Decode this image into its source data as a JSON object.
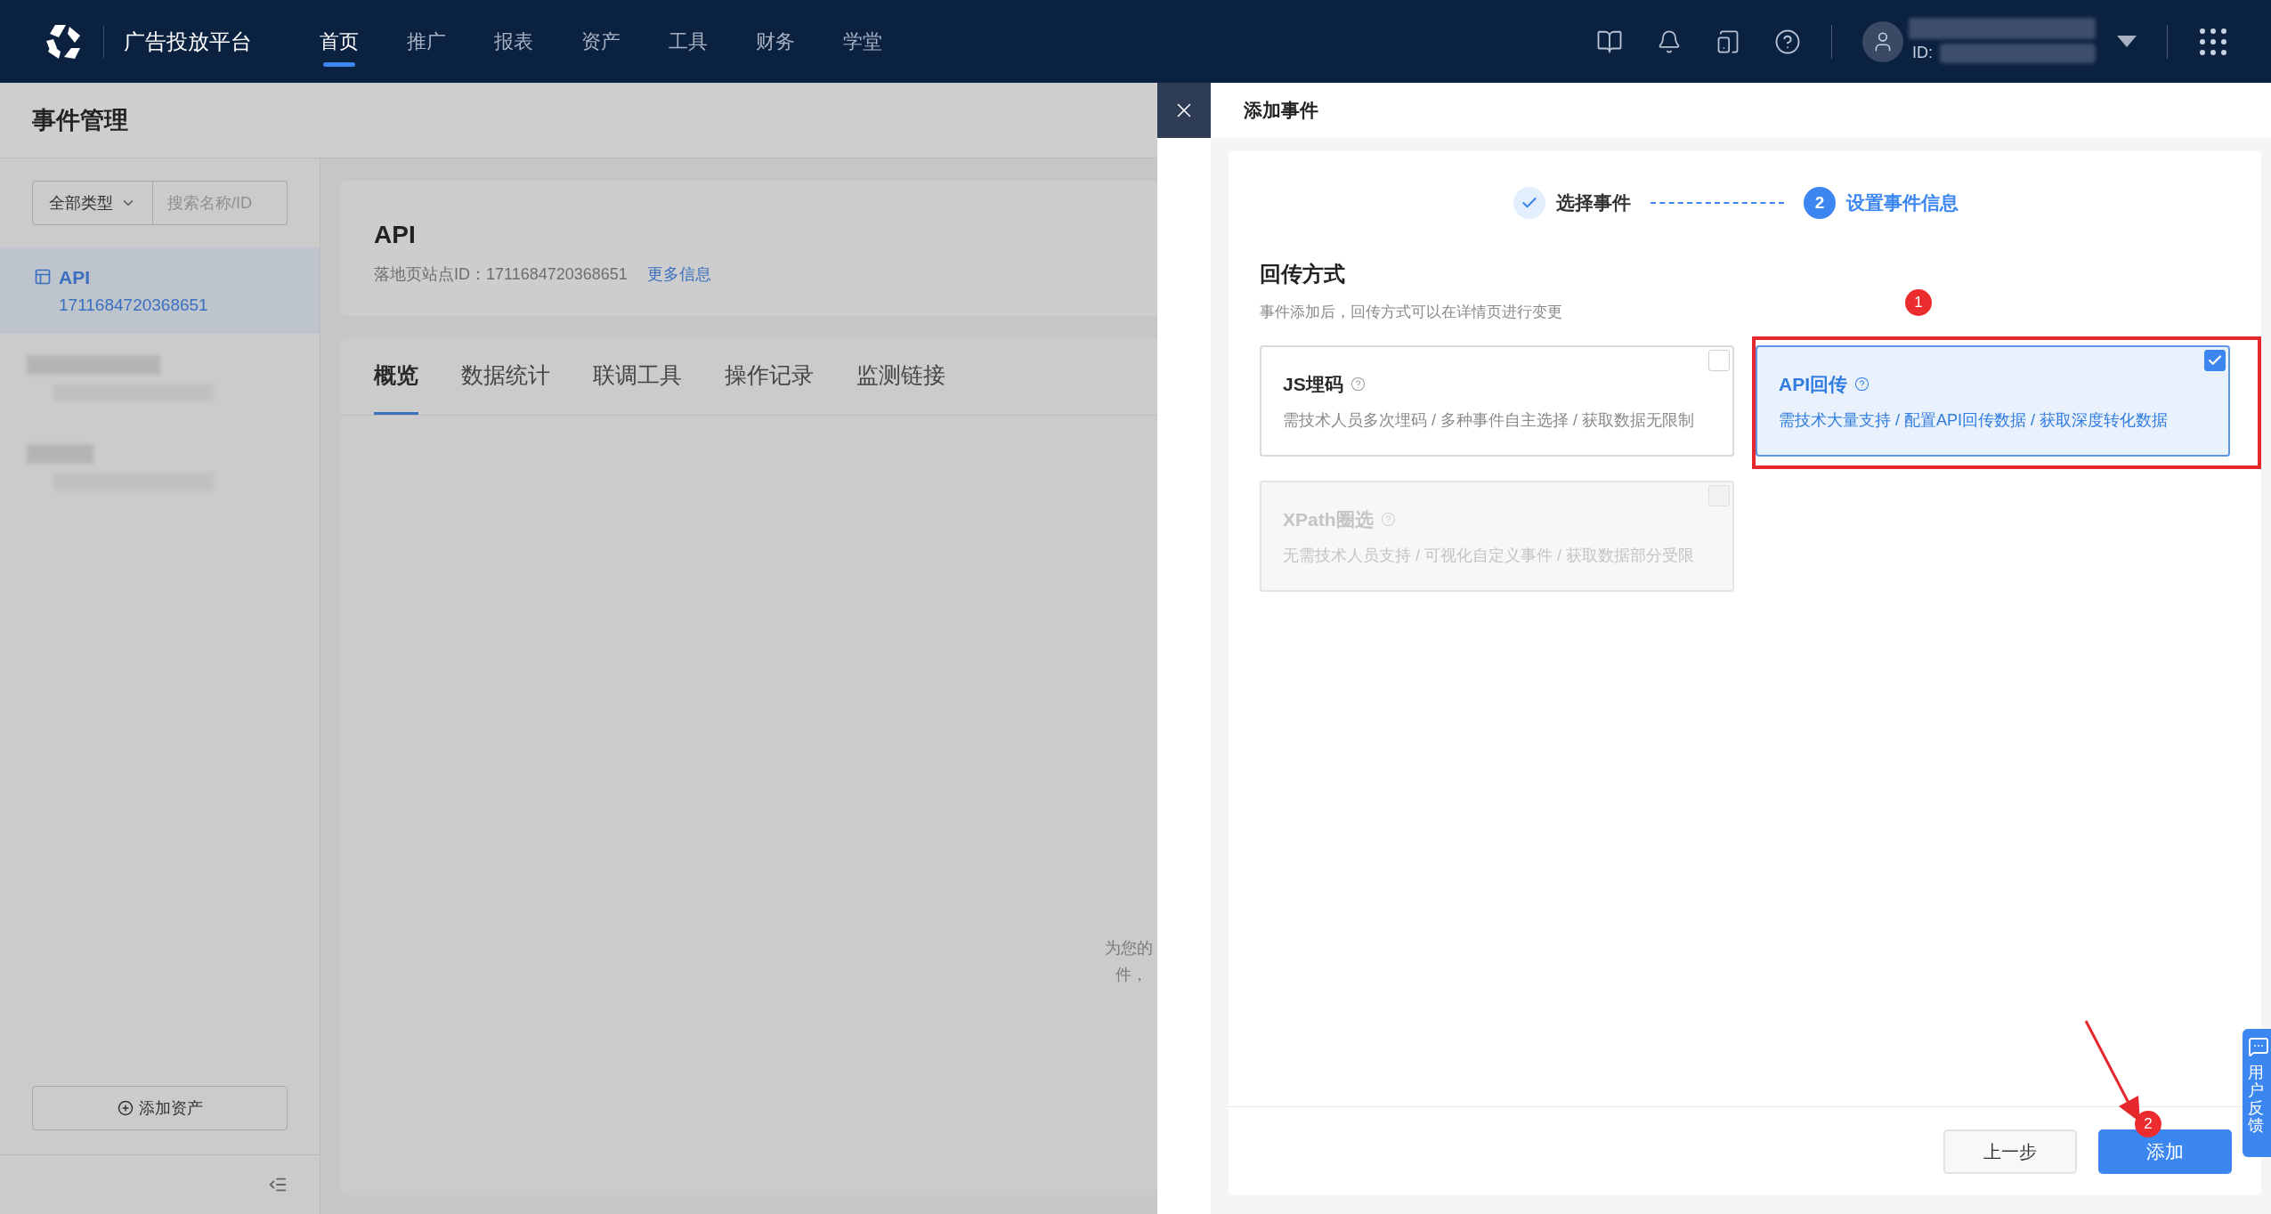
{
  "top_nav": {
    "brand": "广告投放平台",
    "items": [
      {
        "label": "首页",
        "selected": true
      },
      {
        "label": "推广",
        "selected": false
      },
      {
        "label": "报表",
        "selected": false
      },
      {
        "label": "资产",
        "selected": false
      },
      {
        "label": "工具",
        "selected": false
      },
      {
        "label": "财务",
        "selected": false
      },
      {
        "label": "学堂",
        "selected": false
      }
    ],
    "user": {
      "id_label": "ID:"
    }
  },
  "page": {
    "title": "事件管理"
  },
  "sidebar": {
    "type_filter": "全部类型",
    "search": {
      "placeholder": "搜索名称/ID"
    },
    "items": [
      {
        "kind": "asset",
        "name": "API",
        "id": "1711684720368651",
        "selected": true
      },
      {
        "kind": "blurred",
        "selected": false
      },
      {
        "kind": "blurred",
        "selected": false
      }
    ],
    "add_button": "添加资产"
  },
  "asset": {
    "name": "API",
    "site_id_label": "落地页站点ID：",
    "site_id": "1711684720368651",
    "more_link": "更多信息"
  },
  "tabs": [
    {
      "label": "概览",
      "selected": true
    },
    {
      "label": "数据统计",
      "selected": false
    },
    {
      "label": "联调工具",
      "selected": false
    },
    {
      "label": "操作记录",
      "selected": false
    },
    {
      "label": "监测链接",
      "selected": false
    }
  ],
  "empty_hint_lines": [
    "为您的",
    "件，"
  ],
  "drawer": {
    "title": "添加事件",
    "steps": [
      {
        "kind": "done",
        "label": "选择事件"
      },
      {
        "kind": "current",
        "number": "2",
        "label": "设置事件信息"
      }
    ],
    "section_title": "回传方式",
    "section_hint": "事件添加后，回传方式可以在详情页进行变更",
    "options": [
      {
        "title": "JS埋码",
        "description": "需技术人员多次埋码 / 多种事件自主选择 / 获取数据无限制",
        "selected": false,
        "disabled": false
      },
      {
        "title": "API回传",
        "description": "需技术大量支持 / 配置API回传数据 / 获取深度转化数据",
        "selected": true,
        "disabled": false,
        "annotation": "1"
      },
      {
        "title": "XPath圈选",
        "description": "无需技术人员支持 / 可视化自定义事件 / 获取数据部分受限",
        "selected": false,
        "disabled": true
      }
    ],
    "back_button": "上一步",
    "submit_button": "添加",
    "submit_annotation": "2"
  },
  "feedback_tab": {
    "label": "用户反馈"
  }
}
